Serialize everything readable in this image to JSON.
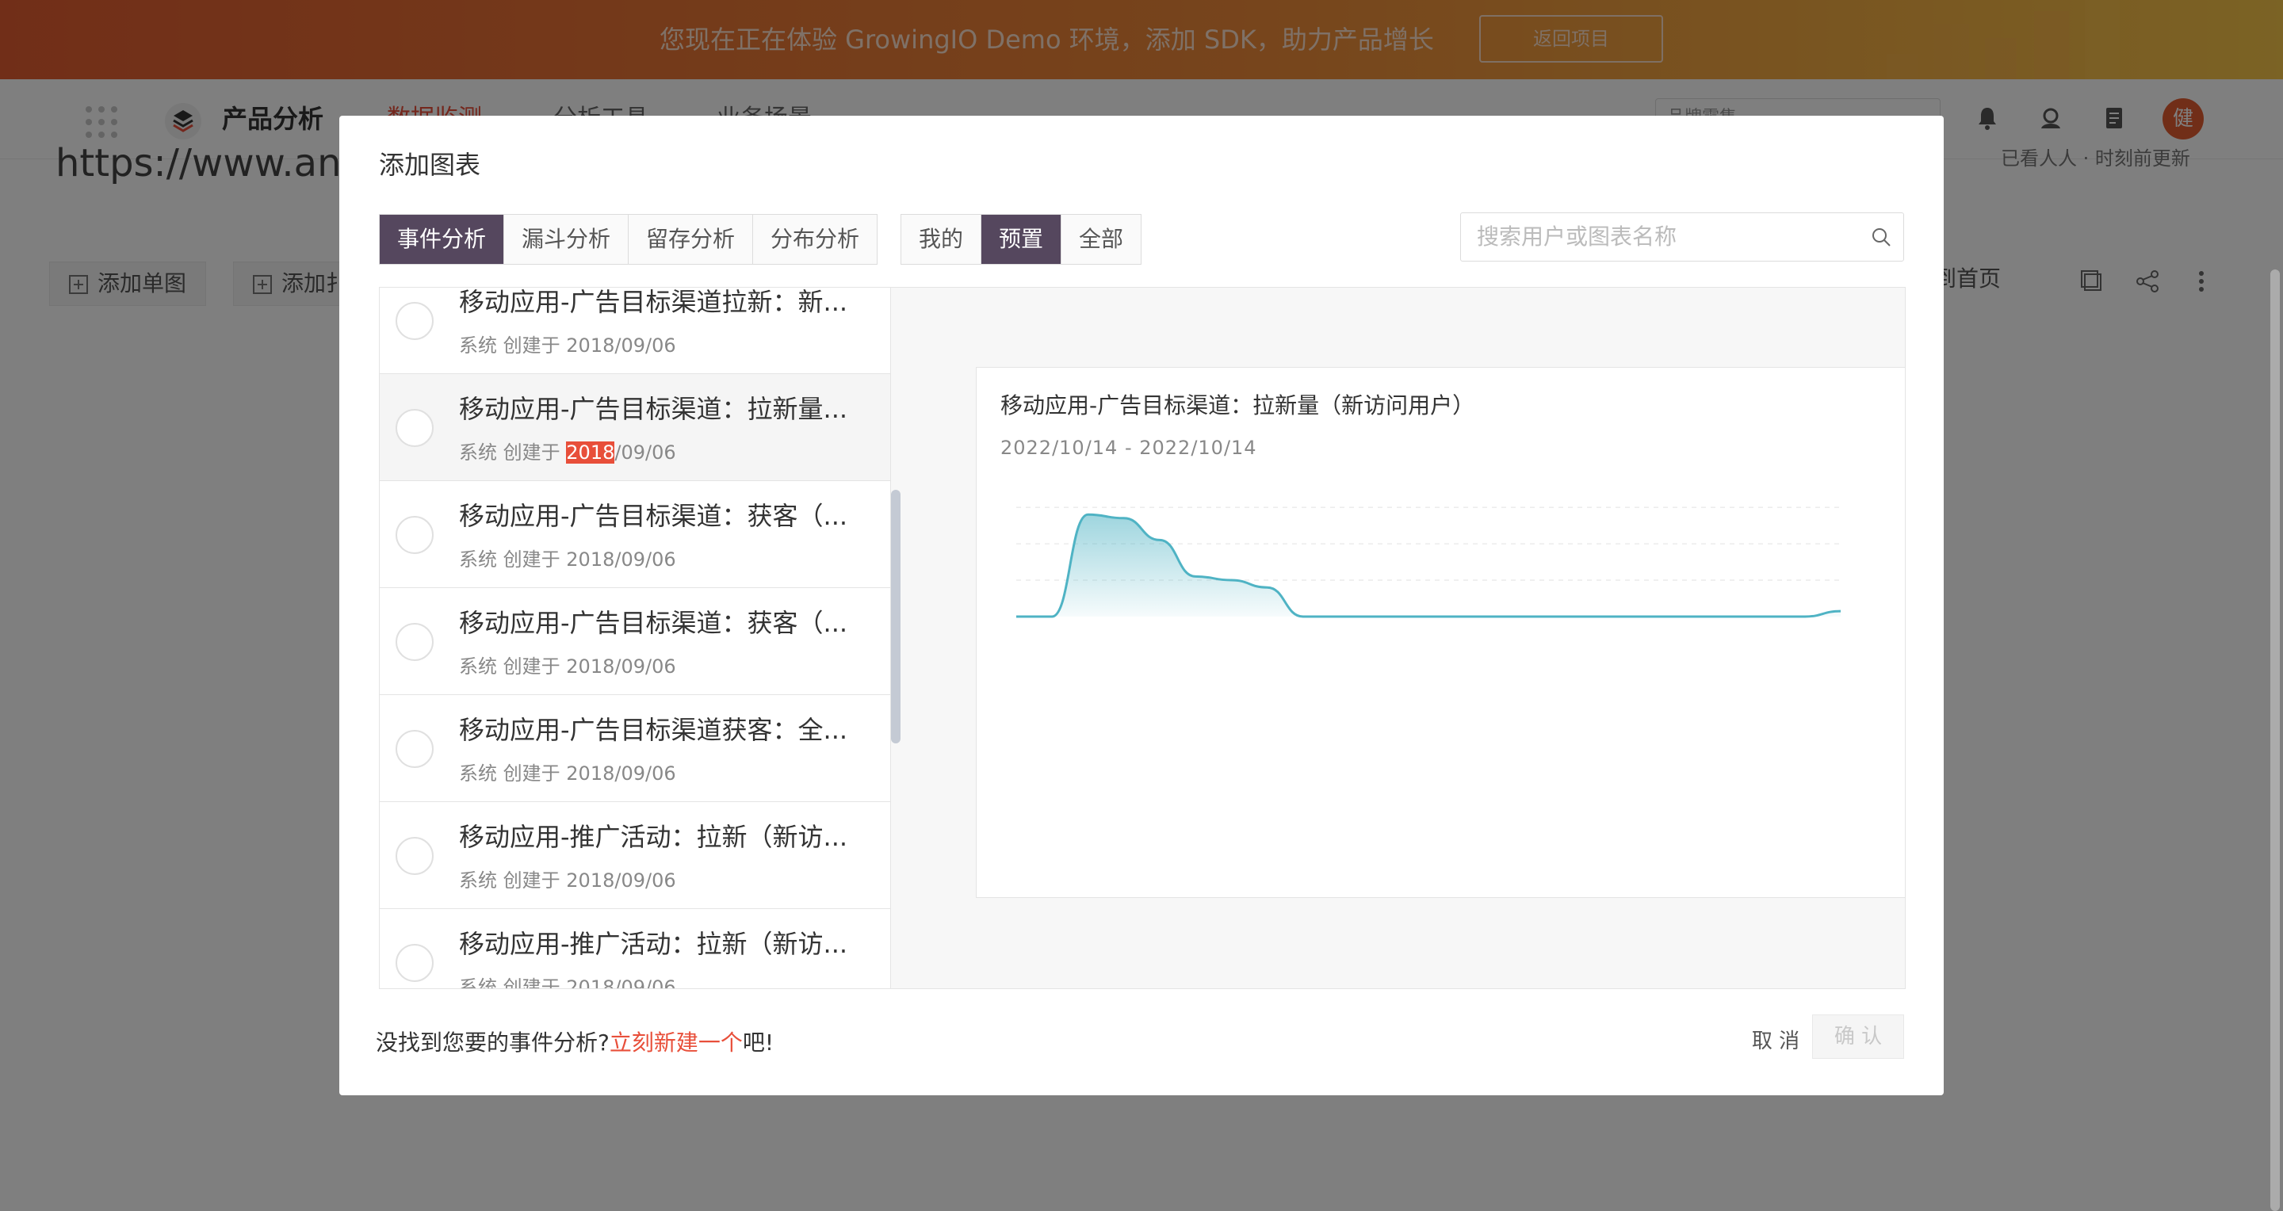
{
  "banner": {
    "text": "您现在正在体验 GrowingIO Demo 环境，添加 SDK，助力产品增长",
    "button": "返回项目",
    "colors": {
      "start": "#e35d31",
      "end": "#f7c64a"
    }
  },
  "nav": {
    "product_title": "产品分析",
    "items": [
      {
        "label": "数据监测",
        "active": true
      },
      {
        "label": "分析工具",
        "active": false
      },
      {
        "label": "业务场景",
        "active": false
      }
    ],
    "search_placeholder": "品牌零售",
    "avatar_initial": "健",
    "accent": "#e84f3a"
  },
  "page": {
    "url_fragment": "https://www.any",
    "sub_right": "已看人人 · 时刻前更新",
    "buttons": [
      "添加单图",
      "添加扌"
    ],
    "right_text": "到首页"
  },
  "modal": {
    "title": "添加图表",
    "type_tabs": [
      {
        "label": "事件分析",
        "active": true
      },
      {
        "label": "漏斗分析",
        "active": false
      },
      {
        "label": "留存分析",
        "active": false
      },
      {
        "label": "分布分析",
        "active": false
      }
    ],
    "scope_tabs": [
      {
        "label": "我的",
        "active": false
      },
      {
        "label": "预置",
        "active": true
      },
      {
        "label": "全部",
        "active": false
      }
    ],
    "search_placeholder": "搜索用户或图表名称",
    "list": [
      {
        "title": "移动应用-广告目标渠道拉新：新...",
        "creator": "系统",
        "created_label": "创建于",
        "year": "2018",
        "rest": "/09/06"
      },
      {
        "title": "移动应用-广告目标渠道：拉新量...",
        "creator": "系统",
        "created_label": "创建于",
        "year": "2018",
        "rest": "/09/06"
      },
      {
        "title": "移动应用-广告目标渠道：获客（...",
        "creator": "系统",
        "created_label": "创建于",
        "year": "2018",
        "rest": "/09/06"
      },
      {
        "title": "移动应用-广告目标渠道：获客（...",
        "creator": "系统",
        "created_label": "创建于",
        "year": "2018",
        "rest": "/09/06"
      },
      {
        "title": "移动应用-广告目标渠道获客：全...",
        "creator": "系统",
        "created_label": "创建于",
        "year": "2018",
        "rest": "/09/06"
      },
      {
        "title": "移动应用-推广活动：拉新（新访...",
        "creator": "系统",
        "created_label": "创建于",
        "year": "2018",
        "rest": "/09/06"
      },
      {
        "title": "移动应用-推广活动：拉新（新访...",
        "creator": "系统",
        "created_label": "创建于",
        "year": "2018",
        "rest": "/09/06"
      }
    ],
    "preview": {
      "title": "移动应用-广告目标渠道：拉新量（新访问用户）",
      "date_range": "2022/10/14 - 2022/10/14",
      "line_color": "#4fb3c4"
    },
    "footer": {
      "prefix": "没找到您要的事件分析?",
      "link": "立刻新建一个",
      "suffix": "吧!",
      "cancel": "取 消",
      "confirm": "确 认"
    }
  },
  "chart_data": {
    "type": "area",
    "x": [
      0,
      1,
      2,
      3,
      4,
      5,
      6,
      7,
      8,
      9,
      10,
      11,
      12,
      13,
      14,
      15,
      16,
      17,
      18,
      19,
      20,
      21,
      22,
      23
    ],
    "values": [
      0,
      0,
      2.8,
      2.7,
      2.1,
      1.1,
      1.0,
      0.8,
      0,
      0,
      0,
      0,
      0,
      0,
      0,
      0,
      0,
      0,
      0,
      0,
      0,
      0,
      0,
      0.15
    ],
    "ylim": [
      0,
      3
    ],
    "grid": true,
    "legend": "none"
  }
}
